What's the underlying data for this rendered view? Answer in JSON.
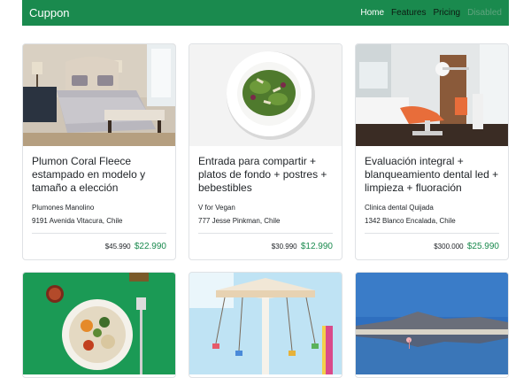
{
  "navbar": {
    "brand": "Cuppon",
    "links": [
      {
        "label": "Home",
        "state": "active"
      },
      {
        "label": "Features",
        "state": "normal"
      },
      {
        "label": "Pricing",
        "state": "normal"
      },
      {
        "label": "Disabled",
        "state": "disabled"
      }
    ]
  },
  "colors": {
    "brand": "#1a8a4e",
    "border": "#dfe2e5"
  },
  "cards": [
    {
      "image": "bedroom-photo",
      "title": "Plumon Coral Fleece estampado en modelo y tamaño a elección",
      "vendor": "Plumones Manolino",
      "address": "9191 Avenida Vitacura, Chile",
      "old_price": "$45.990",
      "new_price": "$22.990"
    },
    {
      "image": "salad-plate-photo",
      "title": "Entrada para compartir + platos de fondo + postres + bebestibles",
      "vendor": "V for Vegan",
      "address": "777 Jesse Pinkman, Chile",
      "old_price": "$30.990",
      "new_price": "$12.990"
    },
    {
      "image": "dental-office-photo",
      "title": "Evaluación integral + blanqueamiento dental led + limpieza + fluoración",
      "vendor": "Clinica dental Quijada",
      "address": "1342 Blanco Encalada, Chile",
      "old_price": "$300.000",
      "new_price": "$25.990"
    },
    {
      "image": "food-bowl-photo"
    },
    {
      "image": "carousel-ride-photo"
    },
    {
      "image": "lake-landscape-photo"
    }
  ]
}
